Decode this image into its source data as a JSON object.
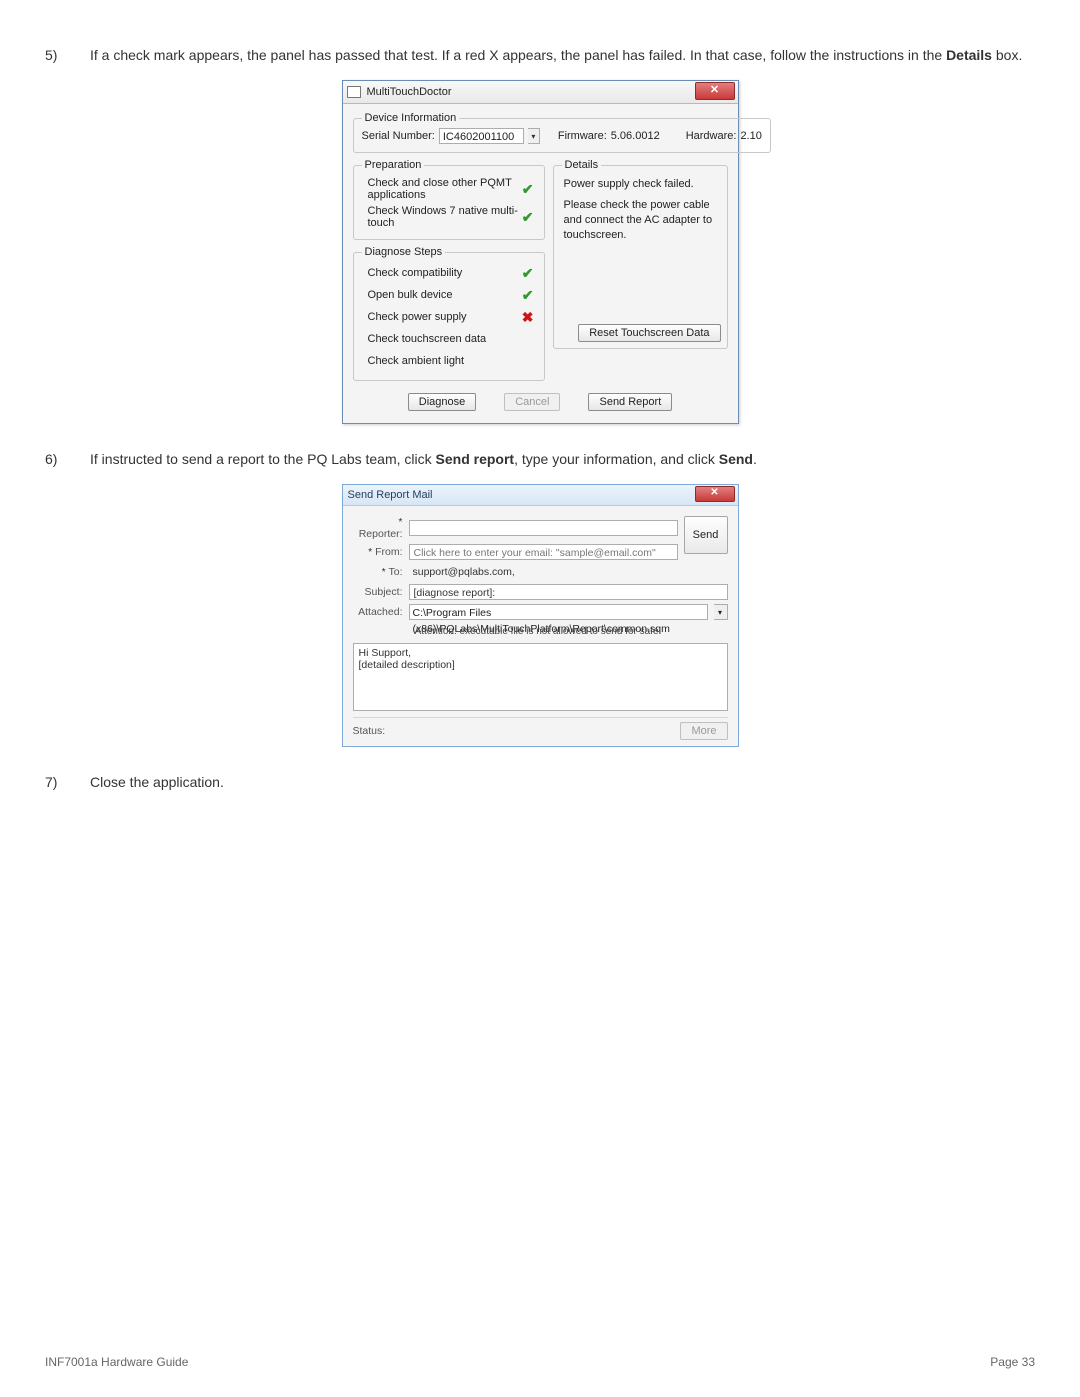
{
  "instructions": {
    "step5": {
      "num": "5)",
      "pre": "If a check mark appears, the panel has passed that test. If a red X appears, the panel has failed. In that case, follow the instructions in the ",
      "bold": "Details",
      "post": " box."
    },
    "step6": {
      "num": "6)",
      "pre": "If instructed to send a report to the PQ Labs team, click ",
      "b1": "Send report",
      "mid": ", type your information, and click ",
      "b2": "Send",
      "post": "."
    },
    "step7": {
      "num": "7)",
      "text": "Close the application."
    }
  },
  "doctor": {
    "title": "MultiTouchDoctor",
    "close_glyph": "✕",
    "device_legend": "Device Information",
    "serial_label": "Serial Number:",
    "serial_value": "IC4602001100",
    "firmware_label": "Firmware:",
    "firmware_value": "5.06.0012",
    "hardware_label": "Hardware:",
    "hardware_value": "2.10",
    "prep_legend": "Preparation",
    "prep1": "Check and close other PQMT applications",
    "prep2": "Check Windows 7 native multi-touch",
    "diag_legend": "Diagnose Steps",
    "d1": "Check compatibility",
    "d2": "Open bulk device",
    "d3": "Check power supply",
    "d4": "Check touchscreen data",
    "d5": "Check ambient light",
    "details_legend": "Details",
    "details_line1": "Power supply check failed.",
    "details_line2": "Please check the power cable and connect the AC adapter to touchscreen.",
    "reset_btn": "Reset Touchscreen Data",
    "diagnose_btn": "Diagnose",
    "cancel_btn": "Cancel",
    "send_report_btn": "Send Report",
    "mark_ok": "✔",
    "mark_bad": "✖"
  },
  "mail": {
    "title": "Send Report Mail",
    "close_glyph": "✕",
    "reporter_label": "Reporter:",
    "from_label": "From:",
    "from_placeholder": "Click here to enter your email: \"sample@email.com\"",
    "to_label": "To:",
    "to_value": "support@pqlabs.com,",
    "subject_label": "Subject:",
    "subject_value": "[diagnose report]:",
    "attached_label": "Attached:",
    "attached_value": "C:\\Program Files (x86)\\PQLabs\\MultiTouchPlatform\\Report\\common.sqm",
    "attention": "Attention: executable file is not allowed to send for safe.",
    "body_line1": "Hi Support,",
    "body_line2": "[detailed description]",
    "status_label": "Status:",
    "send_btn": "Send",
    "more_btn": "More"
  },
  "footer": {
    "left": "INF7001a Hardware Guide",
    "right": "Page 33"
  }
}
